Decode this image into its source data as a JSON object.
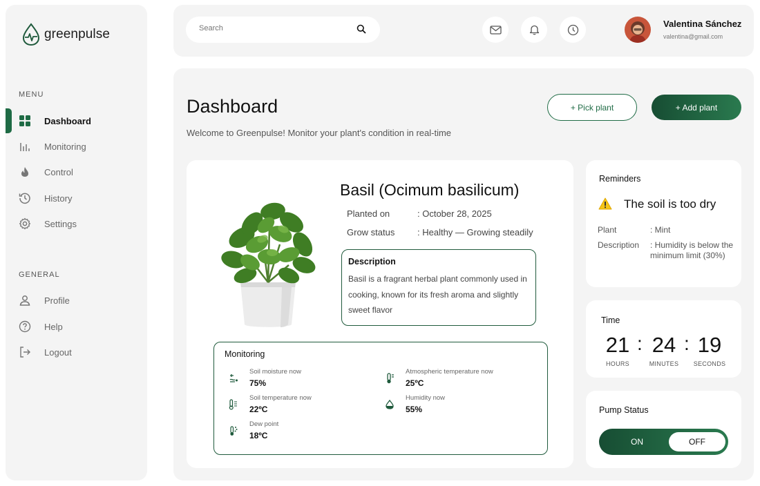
{
  "brand": {
    "name": "greenpulse"
  },
  "sidebar": {
    "menu_label": "MENU",
    "general_label": "GENERAL",
    "menu_items": [
      {
        "label": "Dashboard",
        "icon": "grid-icon",
        "active": true
      },
      {
        "label": "Monitoring",
        "icon": "bar-chart-icon"
      },
      {
        "label": "Control",
        "icon": "flame-icon"
      },
      {
        "label": "History",
        "icon": "history-icon"
      },
      {
        "label": "Settings",
        "icon": "gear-icon"
      }
    ],
    "general_items": [
      {
        "label": "Profile",
        "icon": "user-icon"
      },
      {
        "label": "Help",
        "icon": "help-icon"
      },
      {
        "label": "Logout",
        "icon": "logout-icon"
      }
    ]
  },
  "header": {
    "search_placeholder": "Search",
    "icons": [
      "mail-icon",
      "bell-icon",
      "clock-icon"
    ],
    "user": {
      "name": "Valentina Sánchez",
      "email": "valentina@gmail.com"
    }
  },
  "main": {
    "title": "Dashboard",
    "subtitle": "Welcome to Greenpulse! Monitor your plant's condition in real-time",
    "pick_plant_label": "+ Pick plant",
    "add_plant_label": "+ Add plant"
  },
  "plant": {
    "name": "Basil (Ocimum basilicum)",
    "planted_on_label": "Planted on",
    "planted_on_value": ": October 28, 2025",
    "grow_status_label": "Grow status",
    "grow_status_value": ": Healthy — Growing steadily",
    "description_title": "Description",
    "description_text": "Basil is a fragrant herbal plant commonly used in cooking, known for its fresh aroma and slightly sweet flavor"
  },
  "monitoring": {
    "title": "Monitoring",
    "items": [
      {
        "label": "Soil moisture now",
        "value": "75%",
        "icon": "soil-moisture-icon"
      },
      {
        "label": "Atmospheric temperature now",
        "value": "25ºC",
        "icon": "thermometer-icon"
      },
      {
        "label": "Soil temperature now",
        "value": "22ºC",
        "icon": "soil-temperature-icon"
      },
      {
        "label": "Humidity now",
        "value": "55%",
        "icon": "humidity-drop-icon"
      },
      {
        "label": "Dew point",
        "value": "18ºC",
        "icon": "dew-point-icon"
      }
    ]
  },
  "reminders": {
    "title": "Reminders",
    "message": "The soil is too dry",
    "plant_label": "Plant",
    "plant_value": ": Mint",
    "description_label": "Description",
    "description_value": ": Humidity is below the minimum limit (30%)"
  },
  "time": {
    "title": "Time",
    "hours": "21",
    "minutes": "24",
    "seconds": "19",
    "separator": ":",
    "hours_label": "HOURS",
    "minutes_label": "MINUTES",
    "seconds_label": "SECONDS"
  },
  "pump": {
    "title": "Pump Status",
    "on_label": "ON",
    "off_label": "OFF",
    "selected": "OFF"
  },
  "colors": {
    "accent": "#1f6b45",
    "accent_dark": "#174d33",
    "panel": "#f4f4f4",
    "warning": "#f5c518"
  }
}
